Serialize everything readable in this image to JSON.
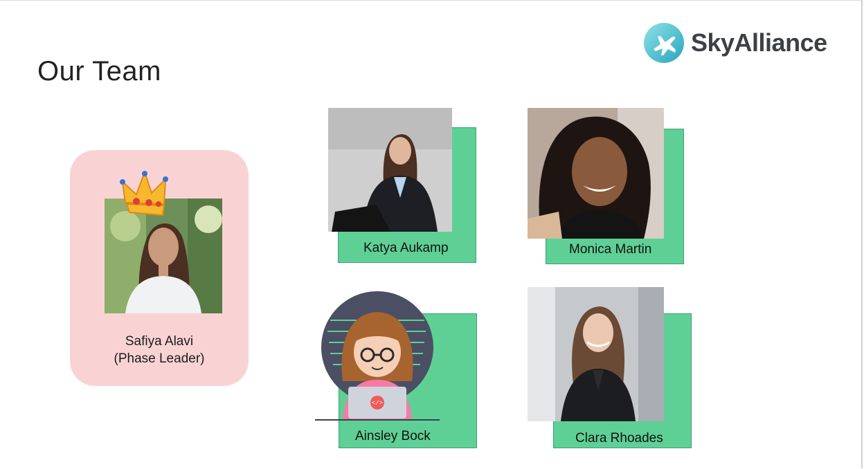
{
  "page": {
    "title": "Our Team"
  },
  "logo": {
    "text": "SkyAlliance",
    "icon": "airplane-icon",
    "accent": "#3fb6c8"
  },
  "colors": {
    "card_green": "#5fd095",
    "leader_card": "#f9d3d3"
  },
  "leader": {
    "name": "Safiya Alavi",
    "role": "(Phase Leader)"
  },
  "members": [
    {
      "name": "Katya Aukamp"
    },
    {
      "name": "Monica Martin"
    },
    {
      "name": "Ainsley Bock"
    },
    {
      "name": "Clara  Rhoades"
    }
  ]
}
